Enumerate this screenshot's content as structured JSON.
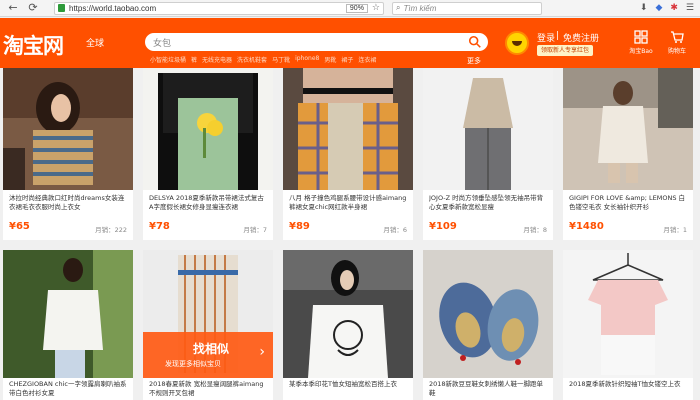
{
  "browser": {
    "url": "https://world.taobao.com",
    "zoom": "90%",
    "search_placeholder": "Tìm kiếm"
  },
  "header": {
    "logo": "淘宝网",
    "logo_sub": "全球",
    "search_placeholder": "女包",
    "hot_words": [
      "小智能垃圾桶",
      "裤",
      "无线充电器",
      "洗衣机鞋套",
      "马丁靴",
      "iphone8",
      "男靴",
      "裙子",
      "连衣裙"
    ],
    "more": "更多",
    "login": "登录",
    "separator": "|",
    "register": "免费注册",
    "coupon": "领取新人专享红包",
    "icon_labels": [
      "淘宝Bao",
      "购物车"
    ]
  },
  "products": [
    {
      "title": "沐拉时尚经典款口红时尚dreams女装连衣裙毛衣衣服时尚上衣女",
      "price": "¥65",
      "sales": "月销：222"
    },
    {
      "title": "DELSYA 2018夏季新款吊带裙法式复古A字度假长裙女修身显瘦连衣裙",
      "price": "¥78",
      "sales": "月销：7"
    },
    {
      "title": "八月 格子撞色鸡腿系腰带设计感aimang裤裙女夏chic网红款半身裙",
      "price": "¥89",
      "sales": "月销：6"
    },
    {
      "title": "JOJO-Z 时尚方领垂坠感坠领无袖吊带背心女夏季新款宽松显瘦",
      "price": "¥109",
      "sales": "月销：8"
    },
    {
      "title": "GIGIPI FOR LOVE &amp; LEMONS 白色镂空毛衣 女长袖针织开衫",
      "price": "¥1480",
      "sales": "月销：1"
    },
    {
      "title": "CHEZGIOBAN chic一字领露肩喇叭袖系带白色衬衫女夏",
      "price": "",
      "sales": ""
    },
    {
      "title": "2018春夏新款 宽松显瘦阔腿裤aimang不规则开叉包裙",
      "price": "",
      "sales": ""
    },
    {
      "title": "某季本季印花T恤女短袖宽松百搭上衣",
      "price": "",
      "sales": ""
    },
    {
      "title": "2018新款豆豆鞋女刺绣懒人鞋一脚蹬单鞋",
      "price": "",
      "sales": ""
    },
    {
      "title": "2018夏季新款针织短袖T恤女镂空上衣",
      "price": "",
      "sales": ""
    }
  ],
  "find_similar": {
    "title": "找相似",
    "subtitle": "发现更多相似宝贝",
    "arrow": "›"
  },
  "colors": {
    "brand": "#ff5000",
    "price": "#ff5000"
  }
}
